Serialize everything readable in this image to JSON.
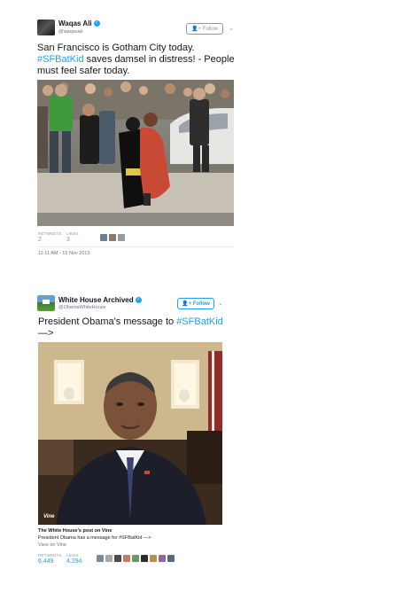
{
  "tweets": [
    {
      "author_name": "Waqas Ali",
      "handle": "@waqasali",
      "follow_label": "Follow",
      "text_before": "San Francisco is Gotham City today. ",
      "hashtag": "#SFBatKid",
      "text_after": " saves damsel in distress!  - People must feel safer today.",
      "retweets_label": "RETWEETS",
      "retweets": "2",
      "likes_label": "LIKES",
      "likes": "3",
      "timestamp": "11:11 AM - 15 Nov 2013",
      "liker_count": 3
    },
    {
      "author_name": "White House Archived",
      "handle": "@ObamaWhiteHouse",
      "follow_label": "Follow",
      "text_before": "President Obama's message to ",
      "hashtag": "#SFBatKid",
      "text_after": " —>",
      "card_title": "The White House's post on Vine",
      "card_description": "President Obama has a message for #SFBatKid —>",
      "card_link": "View on Vine",
      "vine_watermark": "Vine",
      "retweets_label": "RETWEETS",
      "retweets": "6,449",
      "likes_label": "LIKES",
      "likes": "4,294",
      "liker_count": 9
    }
  ],
  "colors": {
    "link": "#1da1f2",
    "muted": "#8899a6",
    "verified": "#1da1f2"
  },
  "icons": [
    "verified-badge-icon",
    "follow-person-icon",
    "chevron-down-icon",
    "vine-logo-icon"
  ]
}
